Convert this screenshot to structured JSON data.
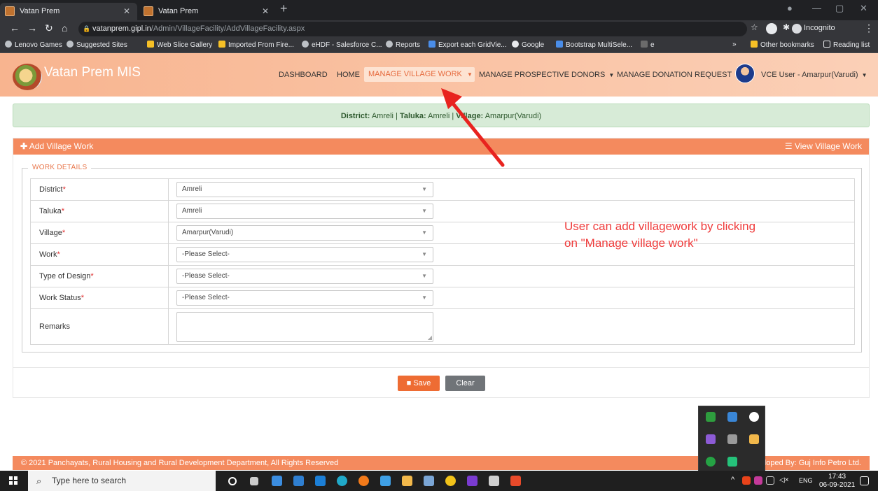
{
  "browser": {
    "tabs": [
      {
        "title": "Vatan Prem"
      },
      {
        "title": "Vatan Prem"
      }
    ],
    "url_host": "vatanprem.gipl.in",
    "url_path": "/Admin/VillageFacility/AddVillageFacility.aspx",
    "incognito_label": "Incognito",
    "bookmarks": [
      "Lenovo Games",
      "Suggested Sites",
      "Web Slice Gallery",
      "Imported From Fire...",
      "eHDF - Salesforce C...",
      "Reports",
      "Export each GridVie...",
      "Google",
      "Bootstrap MultiSele...",
      "e"
    ],
    "other_bookmarks": "Other bookmarks",
    "reading_list": "Reading list"
  },
  "header": {
    "brand": "Vatan Prem MIS",
    "nav": {
      "dashboard": "DASHBOARD",
      "home": "HOME",
      "manage_village_work": "MANAGE VILLAGE WORK",
      "manage_prospective_donors": "MANAGE PROSPECTIVE DONORS",
      "manage_donation_request": "MANAGE DONATION REQUEST"
    },
    "user": "VCE User - Amarpur(Varudi)"
  },
  "location": {
    "district_label": "District:",
    "district": "Amreli",
    "taluka_label": "Taluka:",
    "taluka": "Amreli",
    "village_label": "Village:",
    "village": "Amarpur(Varudi)"
  },
  "panel": {
    "title": "Add Village Work",
    "view_link": "View Village Work",
    "legend": "WORK DETAILS",
    "fields": [
      {
        "label": "District",
        "value": "Amreli"
      },
      {
        "label": "Taluka",
        "value": "Amreli"
      },
      {
        "label": "Village",
        "value": "Amarpur(Varudi)"
      },
      {
        "label": "Work",
        "value": "-Please Select-"
      },
      {
        "label": "Type of Design",
        "value": "-Please Select-"
      },
      {
        "label": "Work Status",
        "value": "-Please Select-"
      }
    ],
    "remarks_label": "Remarks",
    "required_mark": "*",
    "save": "Save",
    "clear": "Clear"
  },
  "annotation": {
    "line1": "User can add villagework by clicking",
    "line2": "on \"Manage village work\"",
    "color": "#ef3b3b"
  },
  "footer": {
    "left": "© 2021 Panchayats, Rural Housing and Rural Development Department, All Rights Reserved",
    "right": "loped By: Guj Info Petro Ltd."
  },
  "taskbar": {
    "search_placeholder": "Type here to search",
    "lang": "ENG",
    "time": "17:43",
    "date": "06-09-2021"
  },
  "colors": {
    "accent": "#f48a5e",
    "save": "#ee6c33",
    "clear": "#707478",
    "banner": "#d7ebd7"
  }
}
